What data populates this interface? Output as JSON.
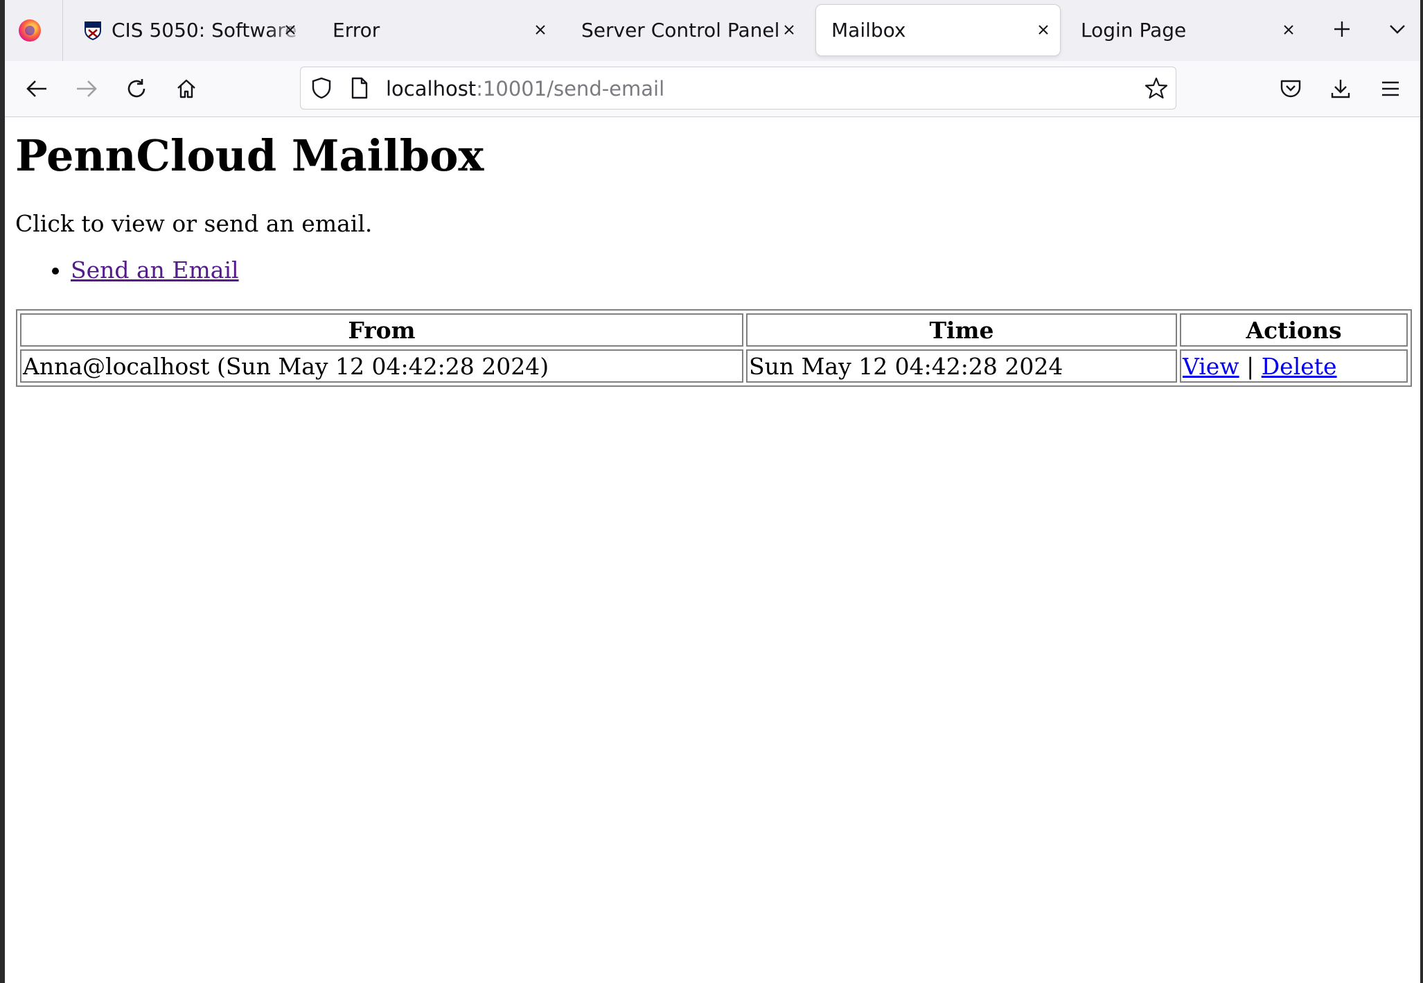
{
  "browser": {
    "tabs": [
      {
        "label": "CIS 5050: Software",
        "selected": false
      },
      {
        "label": "Error",
        "selected": false
      },
      {
        "label": "Server Control Panel",
        "selected": false
      },
      {
        "label": "Mailbox",
        "selected": true
      },
      {
        "label": "Login Page",
        "selected": false
      }
    ],
    "url_host": "localhost",
    "url_path": ":10001/send-email"
  },
  "page": {
    "title": "PennCloud Mailbox",
    "intro": "Click to view or send an email.",
    "links": [
      {
        "label": "Send an Email"
      }
    ],
    "table": {
      "headers": [
        "From",
        "Time",
        "Actions"
      ],
      "rows": [
        {
          "from": "Anna@localhost (Sun May 12 04:42:28 2024)",
          "time": "Sun May 12 04:42:28 2024",
          "view_label": "View",
          "separator": "|",
          "delete_label": "Delete"
        }
      ]
    }
  },
  "colors": {
    "visited_link": "#551a8b",
    "link": "#0000ee",
    "table_border": "#808080"
  }
}
